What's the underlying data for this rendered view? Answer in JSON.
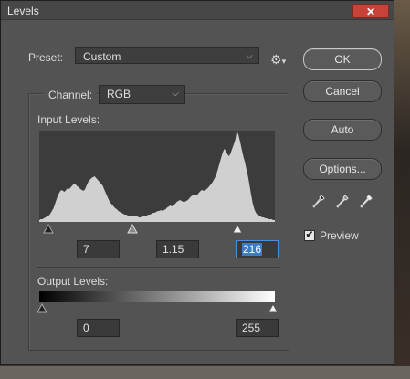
{
  "window": {
    "title": "Levels",
    "close_glyph": "✕"
  },
  "preset": {
    "label": "Preset:",
    "value": "Custom",
    "gear_icon": "gear-icon"
  },
  "channel": {
    "label": "Channel:",
    "value": "RGB"
  },
  "input_levels": {
    "label": "Input Levels:",
    "black": "7",
    "gamma": "1.15",
    "white": "216",
    "histogram_levels": [
      2,
      3,
      3,
      4,
      5,
      6,
      7,
      9,
      12,
      15,
      20,
      25,
      30,
      33,
      35,
      34,
      33,
      35,
      37,
      36,
      38,
      40,
      42,
      41,
      39,
      38,
      36,
      35,
      34,
      36,
      40,
      44,
      46,
      48,
      49,
      50,
      48,
      46,
      44,
      42,
      40,
      36,
      32,
      28,
      24,
      21,
      19,
      17,
      15,
      14,
      12,
      11,
      10,
      9,
      8,
      8,
      7,
      7,
      6,
      6,
      6,
      6,
      6,
      5,
      5,
      6,
      6,
      7,
      7,
      8,
      8,
      9,
      10,
      10,
      11,
      12,
      12,
      13,
      12,
      13,
      14,
      16,
      17,
      18,
      17,
      18,
      20,
      22,
      23,
      24,
      23,
      22,
      22,
      23,
      24,
      26,
      28,
      29,
      30,
      29,
      30,
      32,
      34,
      35,
      34,
      35,
      36,
      38,
      40,
      42,
      45,
      48,
      52,
      58,
      64,
      70,
      76,
      80,
      78,
      74,
      72,
      75,
      80,
      85,
      90,
      100,
      95,
      88,
      80,
      72,
      66,
      58,
      50,
      40,
      30,
      20,
      14,
      10,
      8,
      7,
      6,
      5,
      5,
      4,
      4,
      3,
      3,
      3,
      2,
      2
    ]
  },
  "output_levels": {
    "label": "Output Levels:",
    "black": "0",
    "white": "255"
  },
  "buttons": {
    "ok": "OK",
    "cancel": "Cancel",
    "auto": "Auto",
    "options": "Options..."
  },
  "preview": {
    "label": "Preview",
    "checked": true,
    "check_glyph": "✔"
  },
  "eyedroppers": [
    "black-eyedropper-icon",
    "gray-eyedropper-icon",
    "white-eyedropper-icon"
  ],
  "colors": {
    "dialog_bg": "#535353",
    "histogram": "#d0d0d0",
    "selection": "#3d7cc9",
    "close_red": "#c7433a"
  }
}
